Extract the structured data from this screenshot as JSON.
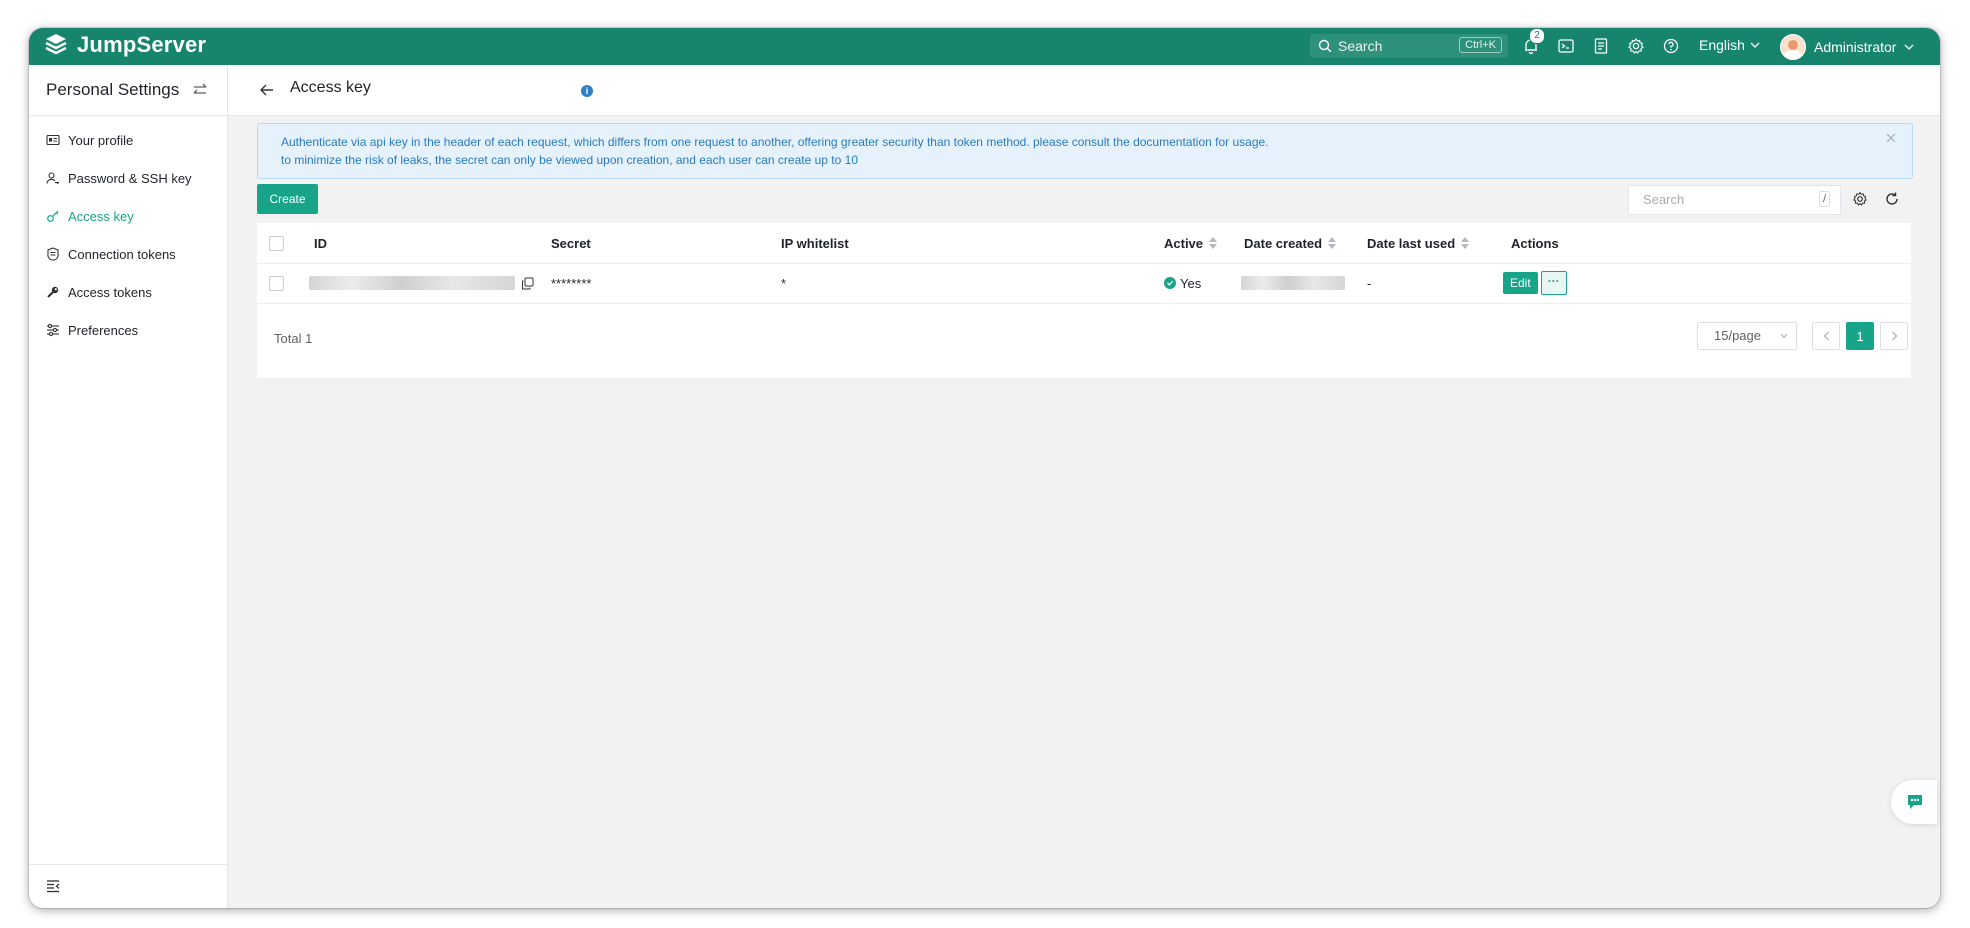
{
  "app": {
    "name": "JumpServer",
    "brand_color": "#17856e",
    "accent_color": "#17a489"
  },
  "topbar": {
    "search_label": "Search",
    "search_shortcut": "Ctrl+K",
    "notification_count": "2",
    "language": "English",
    "user": "Administrator"
  },
  "sidebar": {
    "title": "Personal Settings",
    "items": [
      {
        "label": "Your profile",
        "icon": "id-card-icon"
      },
      {
        "label": "Password & SSH key",
        "icon": "user-key-icon"
      },
      {
        "label": "Access key",
        "icon": "key-icon",
        "active": true
      },
      {
        "label": "Connection tokens",
        "icon": "shield-icon"
      },
      {
        "label": "Access tokens",
        "icon": "wrench-icon"
      },
      {
        "label": "Preferences",
        "icon": "sliders-icon"
      }
    ]
  },
  "page": {
    "title": "Access key"
  },
  "alert": {
    "line1": "Authenticate via api key in the header of each request, which differs from one request to another, offering greater security than token method. please consult the documentation for usage.",
    "line2": "to minimize the risk of leaks, the secret can only be viewed upon creation, and each user can create up to 10"
  },
  "toolbar": {
    "create_label": "Create",
    "search_placeholder": "Search",
    "search_shortcut": "/"
  },
  "table": {
    "columns": [
      "ID",
      "Secret",
      "IP whitelist",
      "Active",
      "Date created",
      "Date last used",
      "Actions"
    ],
    "rows": [
      {
        "secret": "********",
        "ip_whitelist": "*",
        "active": "Yes",
        "date_last_used": "-",
        "edit_label": "Edit",
        "more_label": "···"
      }
    ]
  },
  "pagination": {
    "total": "Total 1",
    "page_size": "15/page",
    "current_page": "1"
  }
}
